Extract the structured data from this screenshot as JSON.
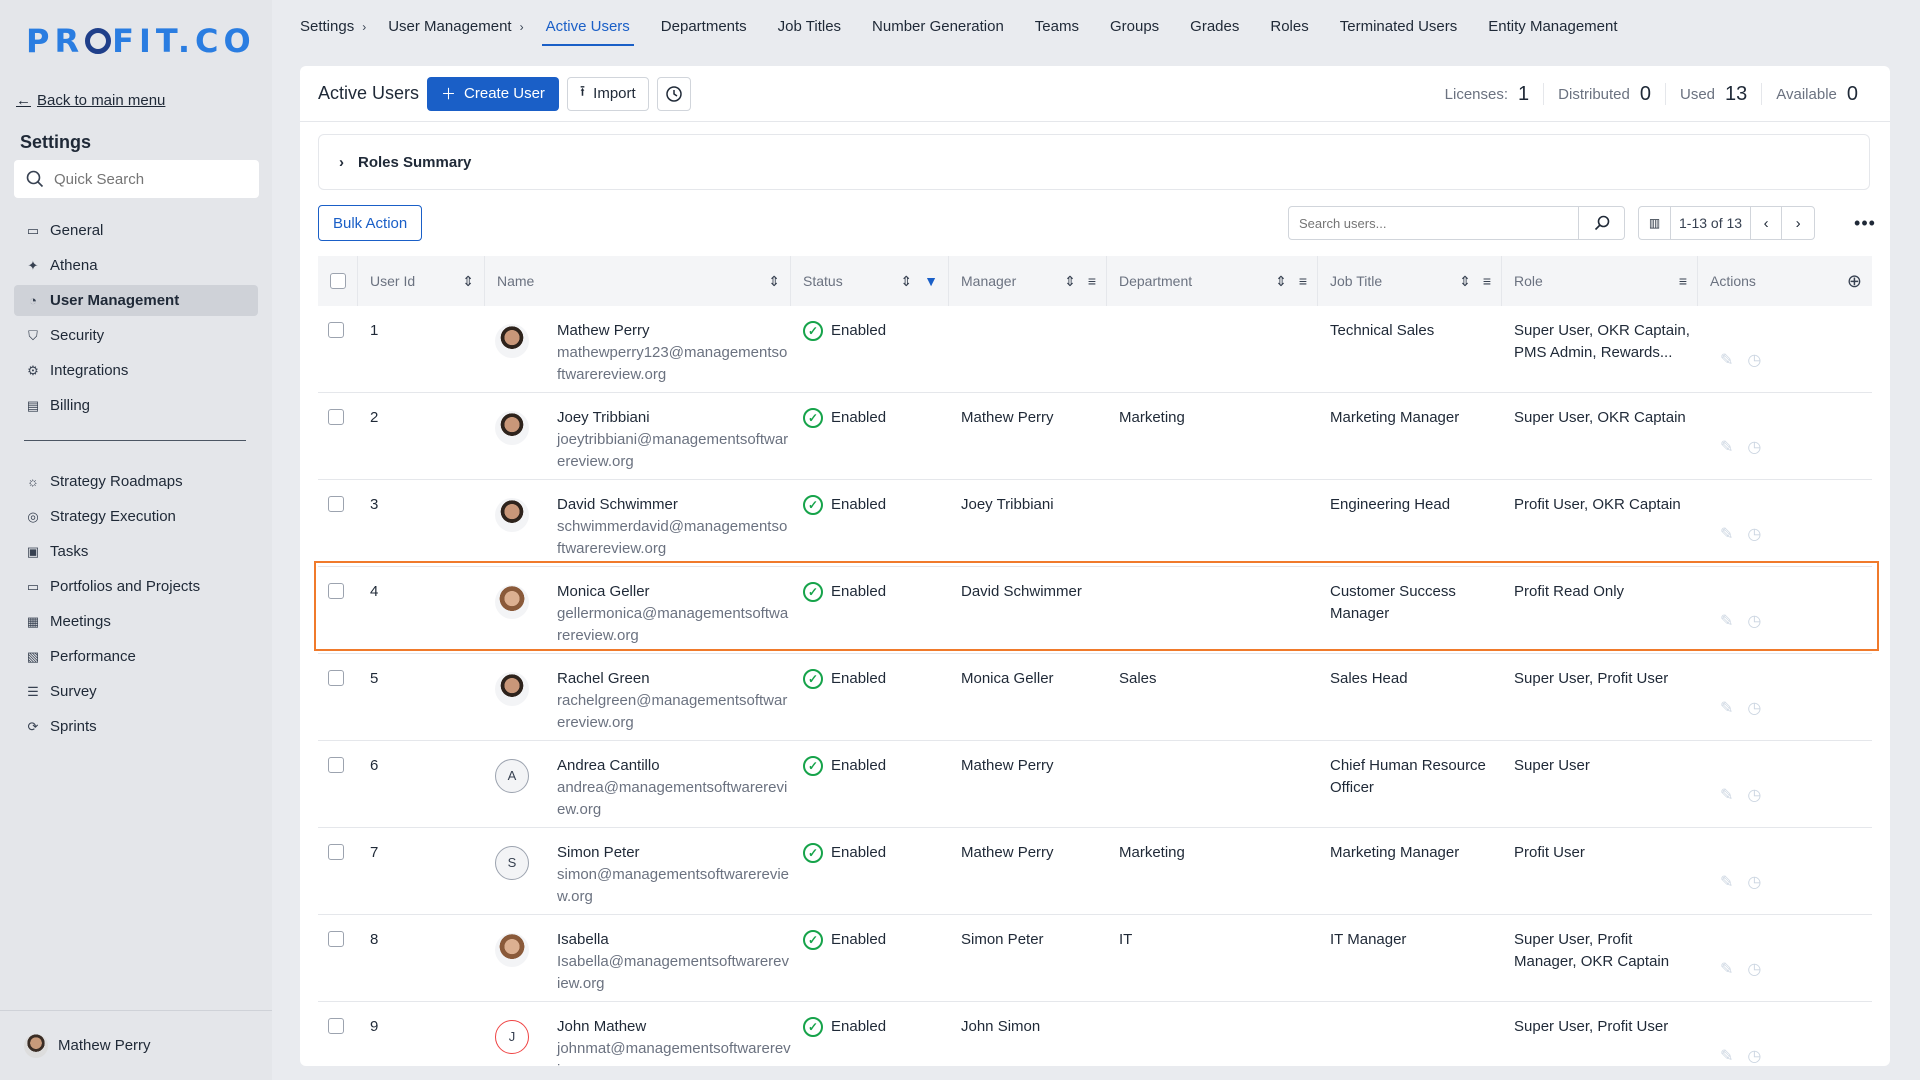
{
  "app": {
    "logo_left": "PR",
    "logo_right": "FIT.CO"
  },
  "sidebar": {
    "back_label": "Back to main menu",
    "title": "Settings",
    "search_placeholder": "Quick Search",
    "items": [
      {
        "label": "General",
        "icon": "monitor-icon"
      },
      {
        "label": "Athena",
        "icon": "sparkle-icon"
      },
      {
        "label": "User Management",
        "icon": "user-icon"
      },
      {
        "label": "Security",
        "icon": "shield-icon"
      },
      {
        "label": "Integrations",
        "icon": "gear-icon"
      },
      {
        "label": "Billing",
        "icon": "receipt-icon"
      }
    ],
    "modules": [
      {
        "label": "Strategy Roadmaps",
        "icon": "bulb-icon"
      },
      {
        "label": "Strategy Execution",
        "icon": "target-icon"
      },
      {
        "label": "Tasks",
        "icon": "clipboard-icon"
      },
      {
        "label": "Portfolios and Projects",
        "icon": "briefcase-icon"
      },
      {
        "label": "Meetings",
        "icon": "meeting-icon"
      },
      {
        "label": "Performance",
        "icon": "chart-icon"
      },
      {
        "label": "Survey",
        "icon": "survey-icon"
      },
      {
        "label": "Sprints",
        "icon": "sprint-icon"
      }
    ],
    "user_name": "Mathew Perry"
  },
  "topnav": {
    "crumbs": [
      "Settings",
      "User Management"
    ],
    "tabs": [
      "Active Users",
      "Departments",
      "Job Titles",
      "Number Generation",
      "Teams",
      "Groups",
      "Grades",
      "Roles",
      "Terminated Users",
      "Entity Management"
    ],
    "active_tab": "Active Users"
  },
  "header": {
    "title": "Active Users",
    "create_label": "Create User",
    "import_label": "Import",
    "licenses": [
      {
        "label": "Licenses:",
        "value": "1"
      },
      {
        "label": "Distributed",
        "value": "0"
      },
      {
        "label": "Used",
        "value": "13"
      },
      {
        "label": "Available",
        "value": "0"
      }
    ]
  },
  "roles_summary": "Roles Summary",
  "toolbar": {
    "bulk_label": "Bulk Action",
    "search_placeholder": "Search users...",
    "page_info": "1-13 of 13"
  },
  "table": {
    "columns": [
      "User Id",
      "Name",
      "Status",
      "Manager",
      "Department",
      "Job Title",
      "Role",
      "Actions"
    ],
    "rows": [
      {
        "id": "1",
        "avatar": "photo",
        "name": "Mathew Perry",
        "email": "mathewperry123@managementsoftwarereview.org",
        "status": "Enabled",
        "manager": "",
        "department": "",
        "job": "Technical Sales",
        "role": "Super User, OKR Captain, PMS Admin, Rewards..."
      },
      {
        "id": "2",
        "avatar": "photo",
        "name": "Joey Tribbiani",
        "email": "joeytribbiani@managementsoftwarereview.org",
        "status": "Enabled",
        "manager": "Mathew Perry",
        "department": "Marketing",
        "job": "Marketing Manager",
        "role": "Super User, OKR Captain"
      },
      {
        "id": "3",
        "avatar": "photo",
        "name": "David Schwimmer",
        "email": "schwimmerdavid@managementsoftwarereview.org",
        "status": "Enabled",
        "manager": "Joey Tribbiani",
        "department": "",
        "job": "Engineering Head",
        "role": "Profit User, OKR Captain"
      },
      {
        "id": "4",
        "avatar": "photo-f",
        "name": "Monica Geller",
        "email": "gellermonica@managementsoftwarereview.org",
        "status": "Enabled",
        "manager": "David Schwimmer",
        "department": "",
        "job": "Customer Success Manager",
        "role": "Profit Read Only"
      },
      {
        "id": "5",
        "avatar": "photo",
        "name": "Rachel Green",
        "email": "rachelgreen@managementsoftwarereview.org",
        "status": "Enabled",
        "manager": "Monica Geller",
        "department": "Sales",
        "job": "Sales Head",
        "role": "Super User, Profit User"
      },
      {
        "id": "6",
        "avatar": "letter",
        "letter": "A",
        "name": "Andrea Cantillo",
        "email": "andrea@managementsoftwarereview.org",
        "status": "Enabled",
        "manager": "Mathew Perry",
        "department": "",
        "job": "Chief Human Resource Officer",
        "role": "Super User"
      },
      {
        "id": "7",
        "avatar": "letter",
        "letter": "S",
        "name": "Simon Peter",
        "email": "simon@managementsoftwarereview.org",
        "status": "Enabled",
        "manager": "Mathew Perry",
        "department": "Marketing",
        "job": "Marketing Manager",
        "role": "Profit User"
      },
      {
        "id": "8",
        "avatar": "photo-f",
        "name": "Isabella",
        "email": "Isabella@managementsoftwarereview.org",
        "status": "Enabled",
        "manager": "Simon Peter",
        "department": "IT",
        "job": "IT Manager",
        "role": "Super User, Profit Manager, OKR Captain"
      },
      {
        "id": "9",
        "avatar": "letter-red",
        "letter": "J",
        "name": "John Mathew",
        "email": "johnmat@managementsoftwarereview.org",
        "status": "Enabled",
        "manager": "John Simon",
        "department": "",
        "job": "",
        "role": "Super User, Profit User"
      }
    ]
  },
  "colors": {
    "accent": "#1a5fc7",
    "highlight": "#f07a2b",
    "success": "#16a34a"
  }
}
